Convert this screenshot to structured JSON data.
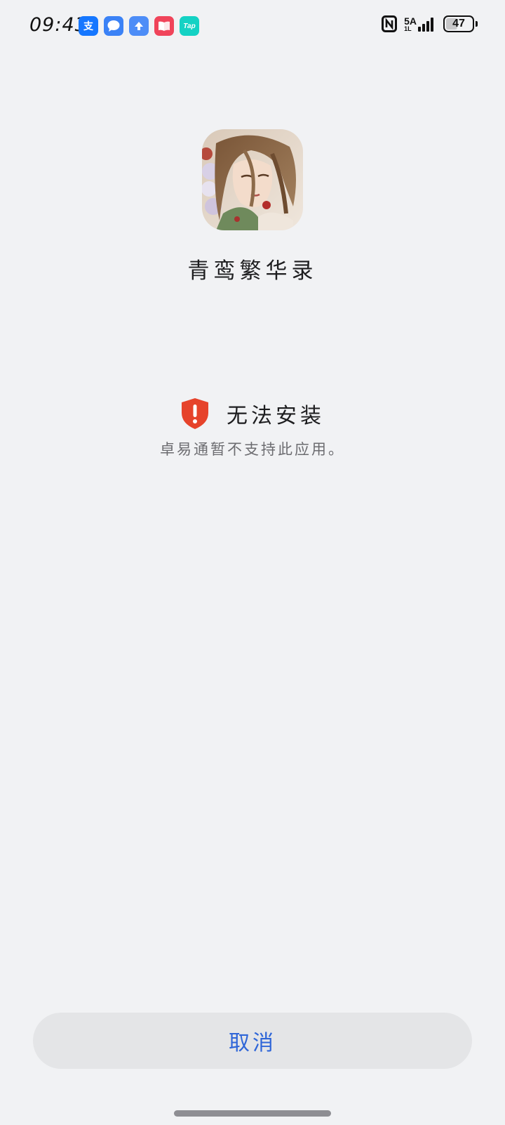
{
  "status_bar": {
    "time": "09:43",
    "notification_icons": [
      {
        "name": "alipay-icon",
        "glyph": "支",
        "color": "#1677ff"
      },
      {
        "name": "message-icon",
        "glyph": "",
        "color": "#3b82f6"
      },
      {
        "name": "upload-icon",
        "glyph": "",
        "color": "#4d8df7"
      },
      {
        "name": "reader-icon",
        "glyph": "",
        "color": "#f0445a"
      },
      {
        "name": "taptap-icon",
        "glyph": "Tap",
        "color": "#14d2c4"
      }
    ],
    "network_label": "5A",
    "network_sub": "1L",
    "battery_level": "47",
    "battery_fraction": 0.47
  },
  "app": {
    "name": "青鸾繁华录"
  },
  "install_status": {
    "title": "无法安装",
    "description": "卓易通暂不支持此应用。",
    "icon_color": "#e6432b"
  },
  "actions": {
    "cancel_label": "取消",
    "accent_color": "#2f66d8"
  }
}
